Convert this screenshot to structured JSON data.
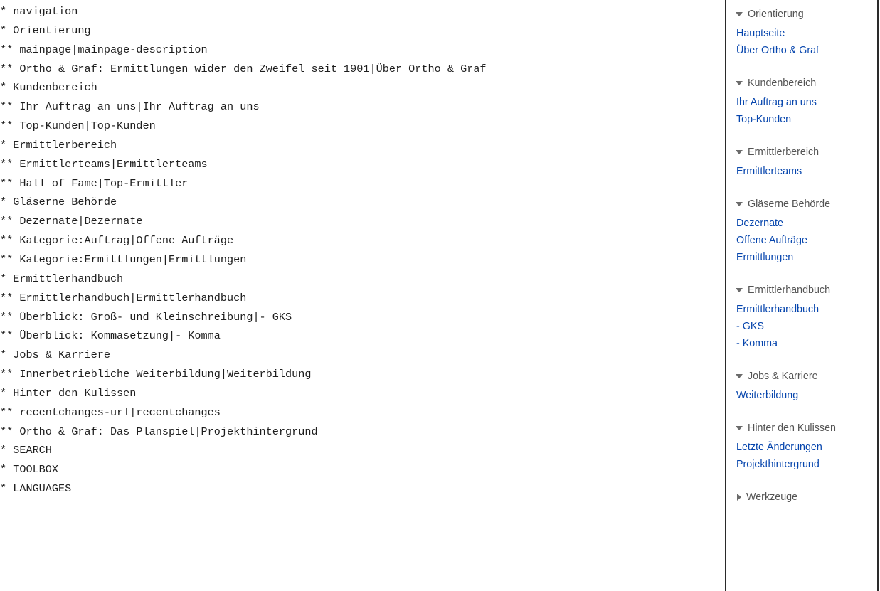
{
  "source_lines": [
    "* navigation",
    "* Orientierung",
    "** mainpage|mainpage-description",
    "** Ortho & Graf: Ermittlungen wider den Zweifel seit 1901|Über Ortho & Graf",
    "* Kundenbereich",
    "** Ihr Auftrag an uns|Ihr Auftrag an uns",
    "** Top-Kunden|Top-Kunden",
    "* Ermittlerbereich",
    "** Ermittlerteams|Ermittlerteams",
    "** Hall of Fame|Top-Ermittler",
    "* Gläserne Behörde",
    "** Dezernate|Dezernate",
    "** Kategorie:Auftrag|Offene Aufträge",
    "** Kategorie:Ermittlungen|Ermittlungen",
    "* Ermittlerhandbuch",
    "** Ermittlerhandbuch|Ermittlerhandbuch",
    "** Überblick: Groß- und Kleinschreibung|- GKS",
    "** Überblick: Kommasetzung|- Komma",
    "* Jobs & Karriere",
    "** Innerbetriebliche Weiterbildung|Weiterbildung",
    "* Hinter den Kulissen",
    "** recentchanges-url|recentchanges",
    "** Ortho & Graf: Das Planspiel|Projekthintergrund",
    "* SEARCH",
    "* TOOLBOX",
    "* LANGUAGES"
  ],
  "sidebar": {
    "colors": {
      "link": "#0645ad",
      "heading": "#545454",
      "border": "#2a2a2a"
    },
    "portals": [
      {
        "heading": "Orientierung",
        "expanded": true,
        "icon": "chevron-down-icon",
        "links": [
          "Hauptseite",
          "Über Ortho & Graf"
        ]
      },
      {
        "heading": "Kundenbereich",
        "expanded": true,
        "icon": "chevron-down-icon",
        "links": [
          "Ihr Auftrag an uns",
          "Top-Kunden"
        ]
      },
      {
        "heading": "Ermittlerbereich",
        "expanded": true,
        "icon": "chevron-down-icon",
        "links": [
          "Ermittlerteams"
        ]
      },
      {
        "heading": "Gläserne Behörde",
        "expanded": true,
        "icon": "chevron-down-icon",
        "links": [
          "Dezernate",
          "Offene Aufträge",
          "Ermittlungen"
        ]
      },
      {
        "heading": "Ermittlerhandbuch",
        "expanded": true,
        "icon": "chevron-down-icon",
        "links": [
          "Ermittlerhandbuch",
          "- GKS",
          "- Komma"
        ]
      },
      {
        "heading": "Jobs & Karriere",
        "expanded": true,
        "icon": "chevron-down-icon",
        "links": [
          "Weiterbildung"
        ]
      },
      {
        "heading": "Hinter den Kulissen",
        "expanded": true,
        "icon": "chevron-down-icon",
        "links": [
          "Letzte Änderungen",
          "Projekthintergrund"
        ]
      },
      {
        "heading": "Werkzeuge",
        "expanded": false,
        "icon": "chevron-right-icon",
        "links": []
      }
    ]
  }
}
